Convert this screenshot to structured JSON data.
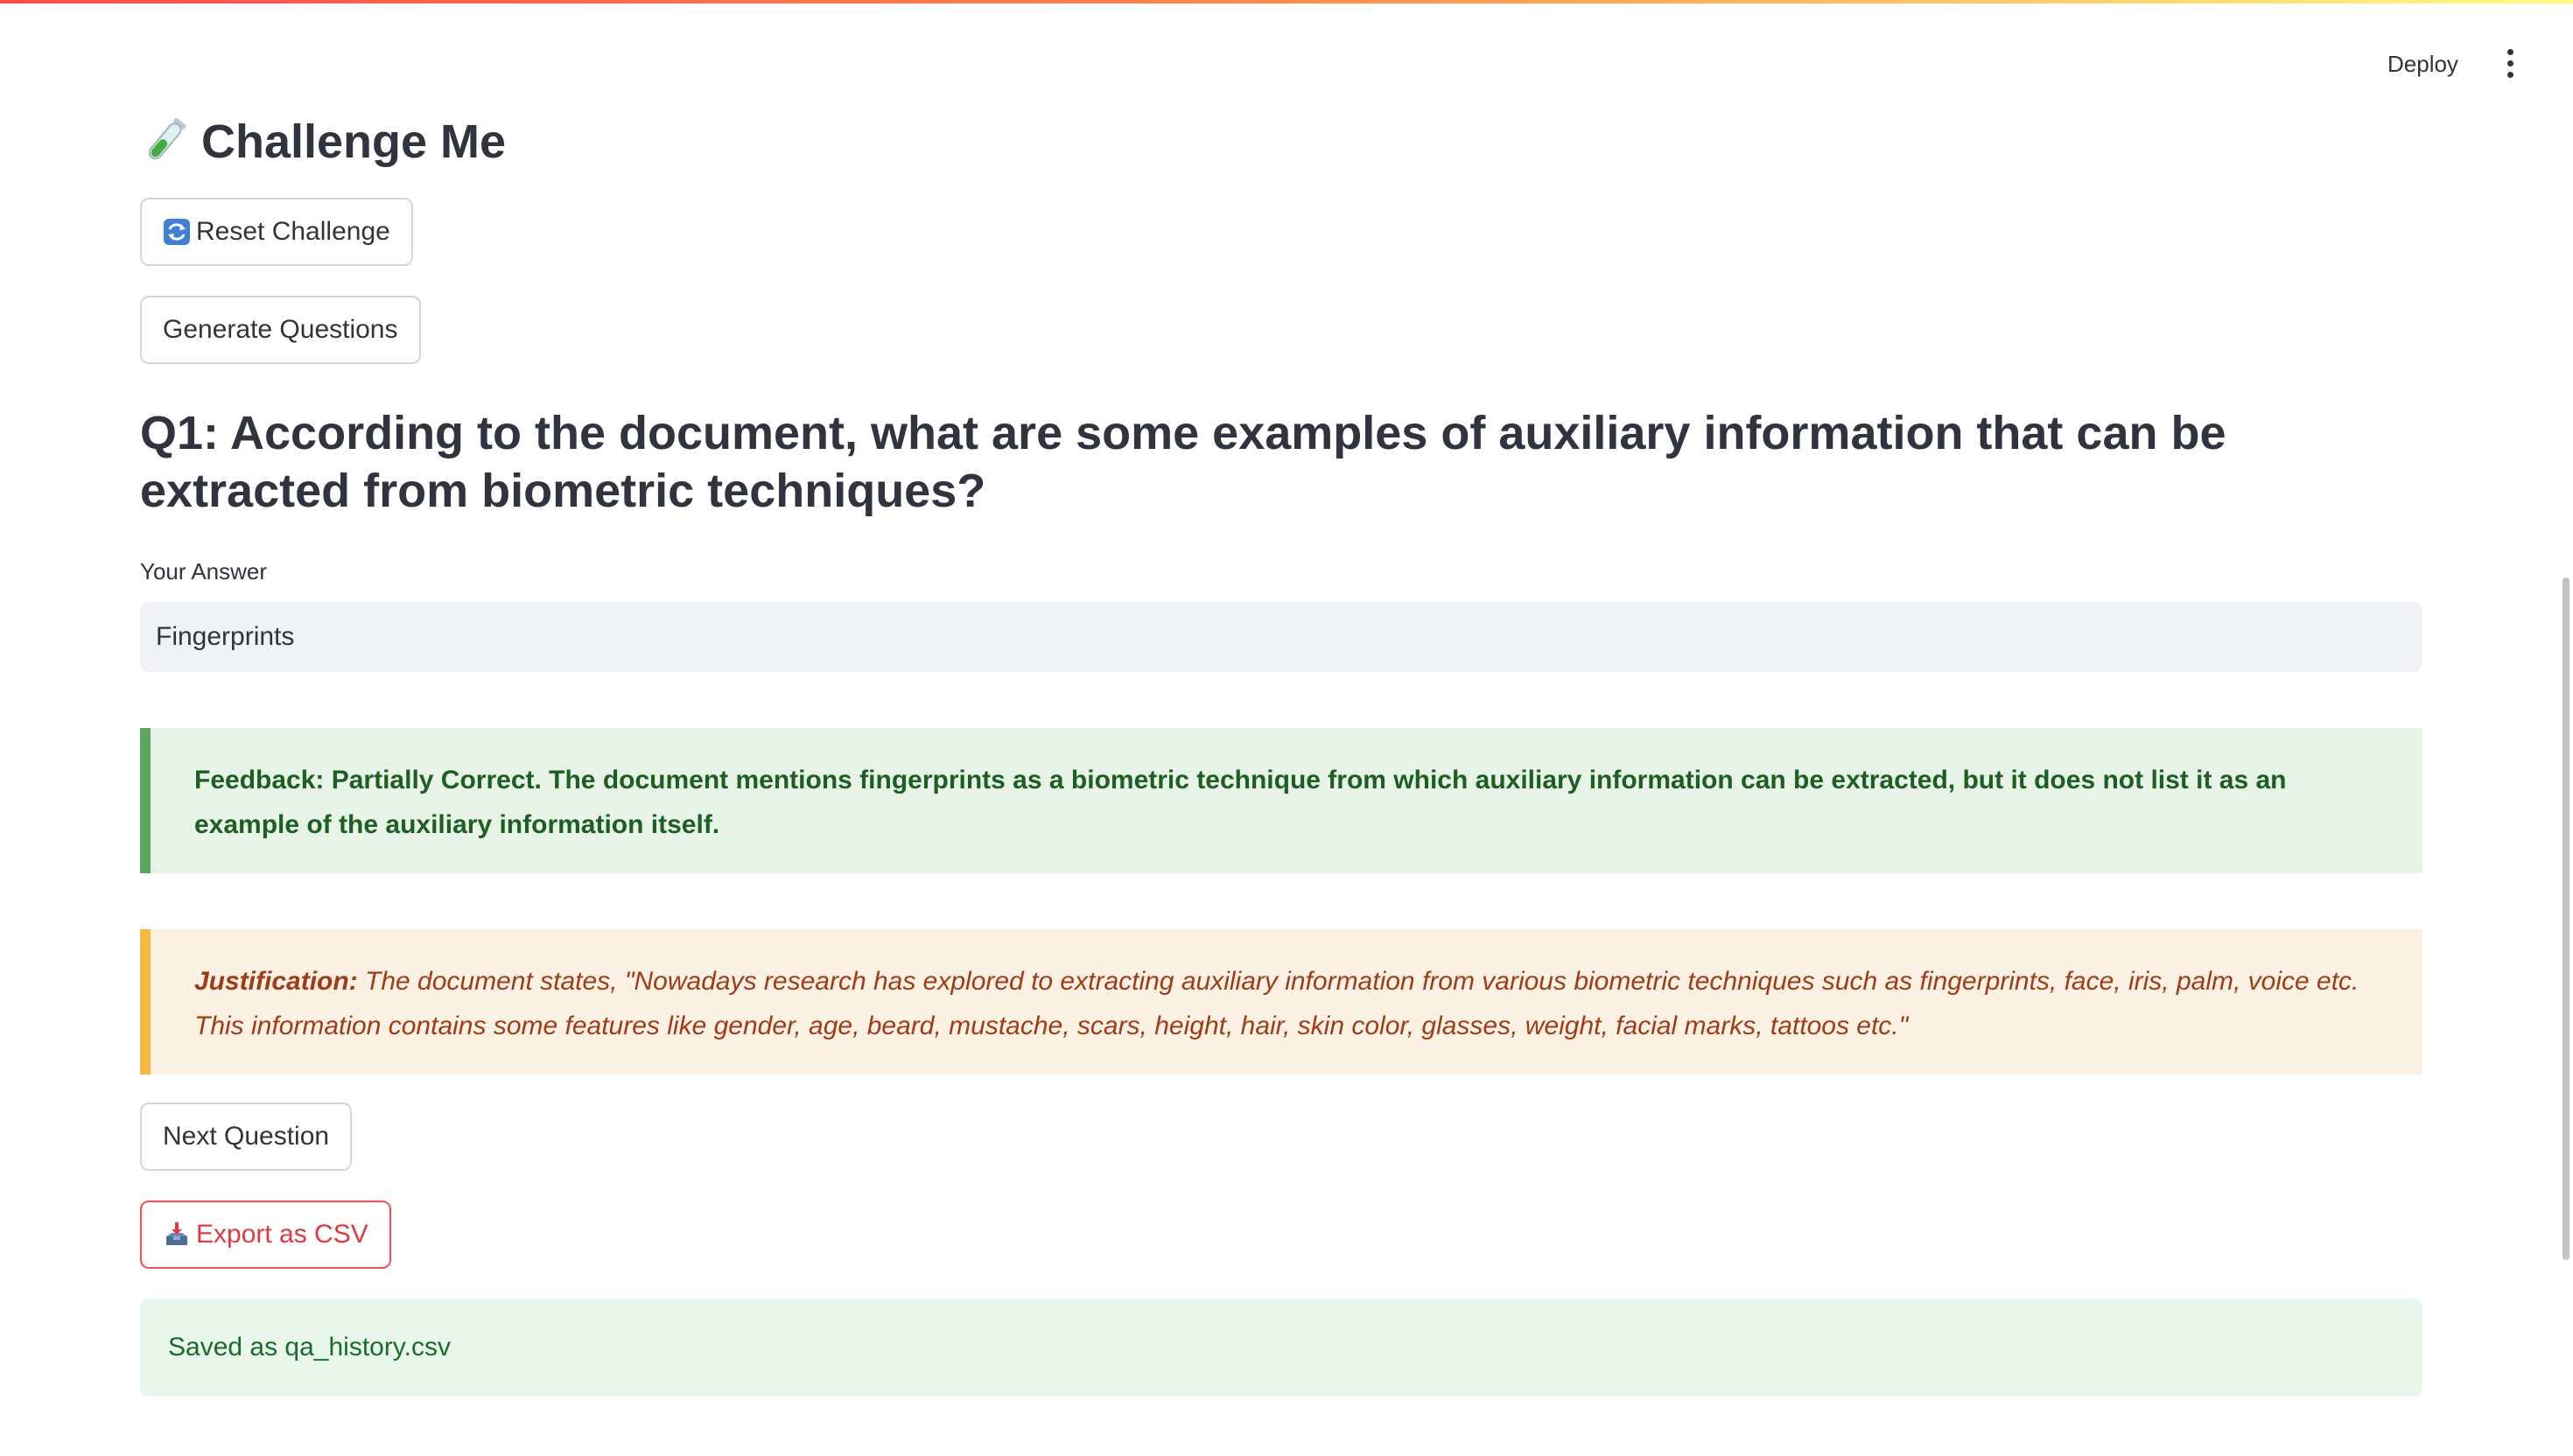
{
  "header": {
    "deploy_label": "Deploy",
    "menu_icon": "kebab-menu-icon"
  },
  "page": {
    "title": "Challenge Me",
    "title_icon": "test-tube-icon"
  },
  "buttons": {
    "reset_label": "Reset Challenge",
    "reset_icon": "reset-arrows-icon",
    "generate_label": "Generate Questions",
    "next_label": "Next Question",
    "export_label": "Export as CSV",
    "export_icon": "inbox-tray-icon"
  },
  "question": {
    "text": "Q1: According to the document, what are some examples of auxiliary information that can be extracted from biometric techniques?"
  },
  "answer": {
    "label": "Your Answer",
    "value": "Fingerprints"
  },
  "feedback": {
    "text": "Feedback: Partially Correct. The document mentions fingerprints as a biometric technique from which auxiliary information can be extracted, but it does not list it as an example of the auxiliary information itself."
  },
  "justification": {
    "label": "Justification:",
    "text": "The document states, \"Nowadays research has explored to extracting auxiliary information from various biometric techniques such as fingerprints, face, iris, palm, voice etc. This information contains some features like gender, age, beard, mustache, scars, height, hair, skin color, glasses, weight, facial marks, tattoos etc.\""
  },
  "status": {
    "saved_message": "Saved as qa_history.csv"
  },
  "colors": {
    "accent": "#ff4b4b",
    "success_bg": "#e8f3e8",
    "success_border": "#5ba55e",
    "warning_bg": "#fcf2e3",
    "warning_border": "#f5b843"
  }
}
